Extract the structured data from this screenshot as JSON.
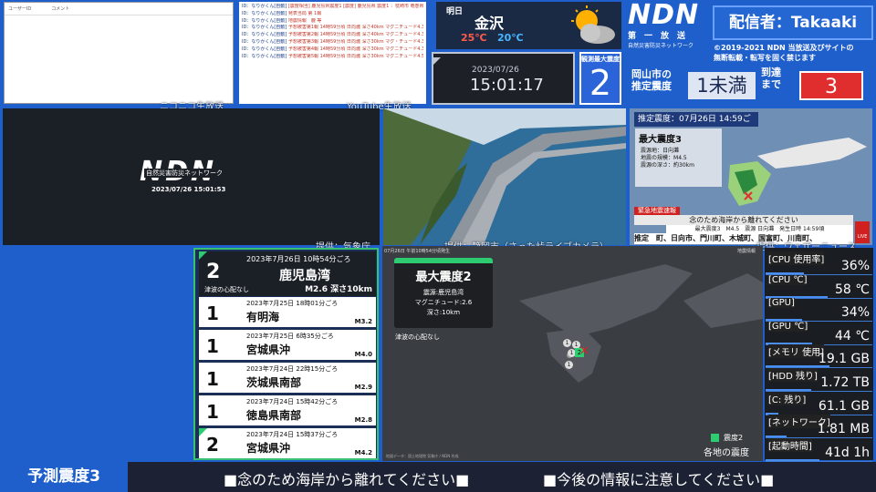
{
  "niconico": {
    "col_user": "ユーザーID",
    "col_comment": "コメント",
    "label": "ニコニコ生放送"
  },
  "youtube": {
    "label": "YouTube生放送",
    "rows": [
      {
        "user": "ID：なりかくん[自動]",
        "msg": "[震度相当] 鹿児島県震度1 [震度] 鹿児島県 震度1 ：枕崎市 竜巻県南部 日置市 肝付町"
      },
      {
        "user": "ID：なりかくん[自動]",
        "msg": "発表当局 第 1報"
      },
      {
        "user": "ID：なりかくん[自動]",
        "msg": "地震情報　鹿 等"
      },
      {
        "user": "ID：なりかくん[自動]",
        "msg": "予想被害第1報 14時59分頃 日向灘 深さ40km マグニチュード4.3 予想震度1"
      },
      {
        "user": "ID：なりかくん[自動]",
        "msg": "予想被害第2報 14時59分頃 日向灘 深さ40km マグニチュード4.3 予想震度1"
      },
      {
        "user": "ID：なりかくん[自動]",
        "msg": "予想被害第3報 14時59分頃 日向灘 深さ30km マグ・チュード4.3 予想震度1"
      },
      {
        "user": "ID：なりかくん[自動]",
        "msg": "予想被害第4報 14時59分頃 日向灘 深さ30km マグニチュード4.3 予想震度2"
      },
      {
        "user": "ID：なりかくん[自動]",
        "msg": "予想被害第5報 14時59分頃 日向灘 深さ30km マグニチュード4.5 予想震度2"
      }
    ]
  },
  "weather": {
    "day": "明日",
    "city": "金沢",
    "high": "25℃",
    "low": "20℃",
    "icon": "partly-cloudy-icon"
  },
  "clock": {
    "date": "2023/07/26",
    "time": "15:01:17"
  },
  "max_shindo": {
    "label": "観測最大震度",
    "value": "2"
  },
  "brand": {
    "logo": "NDN",
    "sub1": "第　一　放　送",
    "sub2": "自然災害防災ネットワーク",
    "broadcaster": "配信者：Takaaki",
    "copyright1": "©2019-2021 NDN 当放送及びサイトの",
    "copyright2": "無断転載・転写を固く禁じます"
  },
  "estimate": {
    "title1": "岡山市の",
    "title2": "推定震度",
    "value": "1未満",
    "arrive1": "到達",
    "arrive2": "まで",
    "arrive_value": "3"
  },
  "ndn_main": {
    "logo": "NDN",
    "tagline": "自然災害防災ネットワーク",
    "datetime": "2023/07/26 15:01:53",
    "source": "提供：気象庁"
  },
  "camera": {
    "source": "提供：静岡市（さった峠ライブカメラ）"
  },
  "nhk": {
    "header": "推定震度：07月26日 14:59ごろ",
    "max": "最大震度3",
    "area_label": "震源地：",
    "area": "日向灘",
    "mag_label": "地震の規模：",
    "mag": "M4.5",
    "depth_label": "震源の深さ：",
    "depth": "約30km",
    "alert": "緊急地震速報",
    "advice": "念のため海岸から離れてください",
    "ticker": "最大震度3　M4.5　震源 日向灘　発生日時 14:59頃",
    "ticker2": "推定　町、日向市、門川町、木城町、国富町、川南町、",
    "source": "提供：ウェザーニュース",
    "live": "LIVE"
  },
  "history": [
    {
      "shindo": "2",
      "time": "2023年7月26日 10時54分ごろ",
      "place": "鹿児島湾",
      "tsunami": "津波の心配なし",
      "mag": "M2.6 深さ10km",
      "color": "#2ecc71"
    },
    {
      "shindo": "1",
      "time": "2023年7月25日 18時01分ごろ",
      "place": "有明海",
      "mag": "M3.2",
      "color": "#ffffff"
    },
    {
      "shindo": "1",
      "time": "2023年7月25日 6時35分ごろ",
      "place": "宮城県沖",
      "mag": "M4.0",
      "color": "#ffffff"
    },
    {
      "shindo": "1",
      "time": "2023年7月24日 22時15分ごろ",
      "place": "茨城県南部",
      "mag": "M2.9",
      "color": "#ffffff"
    },
    {
      "shindo": "1",
      "time": "2023年7月24日 15時42分ごろ",
      "place": "徳島県南部",
      "mag": "M2.8",
      "color": "#ffffff"
    },
    {
      "shindo": "2",
      "time": "2023年7月24日 15時37分ごろ",
      "place": "宮城県沖",
      "mag": "M4.2",
      "color": "#2ecc71"
    }
  ],
  "map": {
    "header": "07月26日 午前10時54分頃発生",
    "corner": "地震情報",
    "max": "最大震度2",
    "epicenter": "震源:鹿児島湾",
    "magnitude": "マグニチュード:2.6",
    "depth": "深さ:10km",
    "tsunami": "津波の心配なし",
    "legend": "震度2",
    "footer_label": "各地の震度",
    "credit": "地図データ：国土地理院 気象庁 / NDN 作成"
  },
  "stats": [
    {
      "label": "[CPU 使用率]",
      "value": "36%",
      "fill": 0.36
    },
    {
      "label": "[CPU ℃]",
      "value": "58 ℃",
      "fill": 0.58
    },
    {
      "label": "[GPU]",
      "value": "34%",
      "fill": 0.34
    },
    {
      "label": "[GPU ℃]",
      "value": "44 ℃",
      "fill": 0.44
    },
    {
      "label": "[メモリ 使用]",
      "value": "19.1 GB",
      "fill": 0.6
    },
    {
      "label": "[HDD 残り]",
      "value": "1.72 TB",
      "fill": 0.43
    },
    {
      "label": "[C: 残り]",
      "value": "61.1 GB",
      "fill": 0.12
    },
    {
      "label": "[ネットワーク]",
      "value": "1.81 MB",
      "fill": 0.2
    },
    {
      "label": "[起動時間]",
      "value": "41d 1h",
      "fill": 0.5
    }
  ],
  "footer": {
    "left": "予測震度3",
    "msg1": "■念のため海岸から離れてください■",
    "msg2": "■今後の情報に注意してください■"
  }
}
